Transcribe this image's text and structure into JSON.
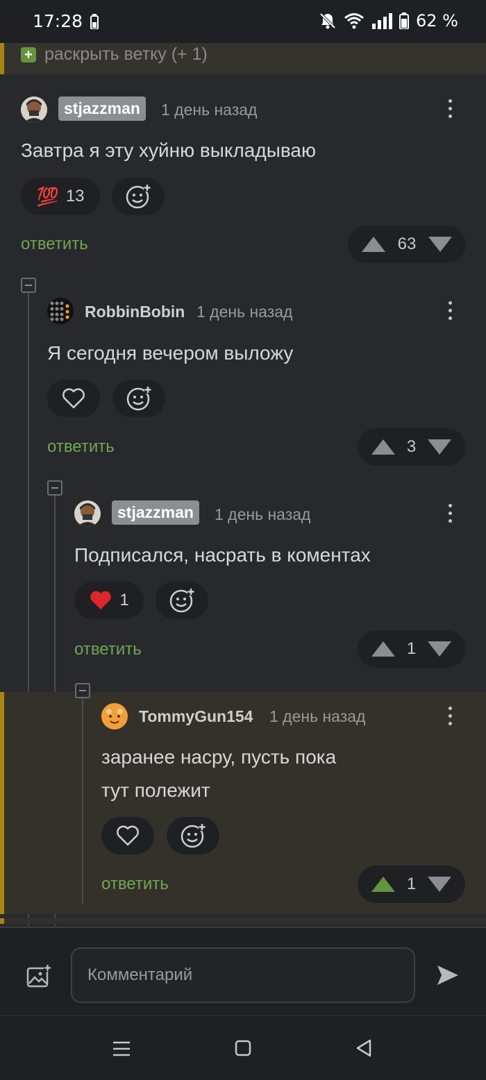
{
  "status_bar": {
    "time": "17:28",
    "battery": "62 %"
  },
  "expand_branch": {
    "label": "раскрыть ветку (+ 1)"
  },
  "comments": [
    {
      "author": "stjazzman",
      "time": "1 день назад",
      "text": "Завтра я эту хуйню выкладываю",
      "reaction_emoji": "💯",
      "reaction_count": "13",
      "reply_label": "ответить",
      "rating": "63"
    },
    {
      "author": "RobbinBobin",
      "time": "1 день назад",
      "text": "Я сегодня вечером выложу",
      "reply_label": "ответить",
      "rating": "3"
    },
    {
      "author": "stjazzman",
      "time": "1 день назад",
      "text": "Подписался, насрать в коментах",
      "reaction_count": "1",
      "reply_label": "ответить",
      "rating": "1"
    },
    {
      "author": "TommyGun154",
      "time": "1 день назад",
      "text_line1": "заранее насру, пусть пока",
      "text_line2": "тут полежит",
      "reply_label": "ответить",
      "rating": "1"
    }
  ],
  "comment_input": {
    "placeholder": "Комментарий"
  },
  "colors": {
    "accent_green": "#62953c",
    "highlight_bar": "#a8860f",
    "heart_red": "#e0262b"
  }
}
